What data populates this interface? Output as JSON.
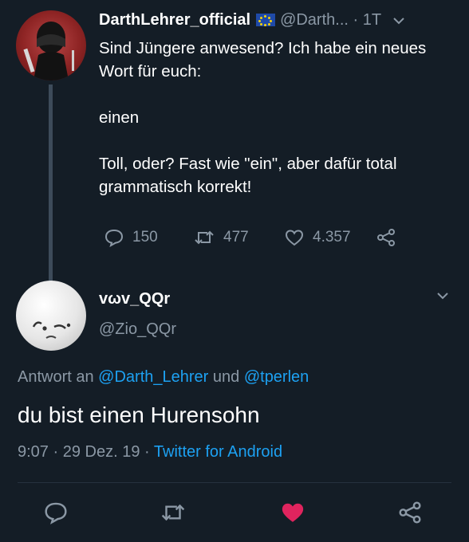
{
  "tweet": {
    "author_name": "DarthLehrer_official",
    "author_handle": "@Darth...",
    "separator": "·",
    "time": "1T",
    "paragraphs": [
      "Sind Jüngere anwesend? Ich habe ein neues Wort für euch:",
      "einen",
      "Toll, oder? Fast wie \"ein\", aber dafür total grammatisch korrekt!"
    ],
    "reply_count": "150",
    "retweet_count": "477",
    "like_count": "4.357"
  },
  "reply": {
    "author_name": "vωv_QQr",
    "author_handle": "@Zio_QQr",
    "reply_to_prefix": "Antwort an",
    "reply_to_user1": "@Darth_Lehrer",
    "reply_to_and": "und",
    "reply_to_user2": "@tperlen",
    "text": "du bist einen Hurensohn",
    "time": "9:07",
    "dot1": "·",
    "date": "29 Dez. 19",
    "dot2": "·",
    "client": "Twitter for Android"
  },
  "icons": {
    "reply": "reply-icon",
    "retweet": "retweet-icon",
    "like": "heart-icon",
    "share": "share-icon",
    "menu": "chevron-down-icon",
    "flag": "eu-flag-icon"
  },
  "colors": {
    "background": "#141d26",
    "text": "#ffffff",
    "muted": "#8b98a5",
    "link": "#1da1f2",
    "like_active": "#e0245e"
  }
}
